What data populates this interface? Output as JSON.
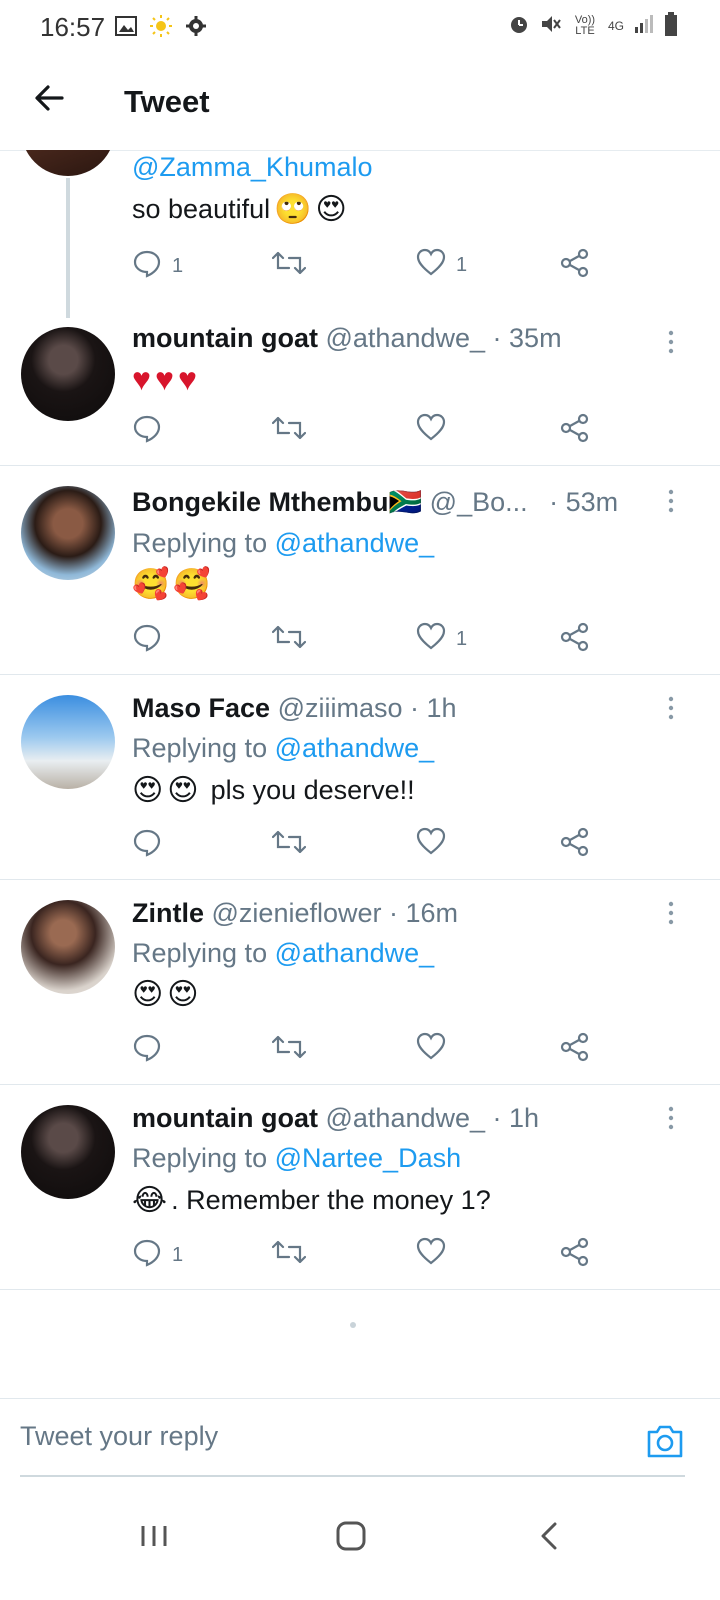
{
  "status_bar": {
    "time": "16:57",
    "left_icons": [
      "image-icon",
      "sun-icon",
      "gear-icon"
    ],
    "right_icons": [
      "alarm-icon",
      "mute-icon",
      "volte-icon",
      "4g-icon",
      "signal-icon",
      "battery-icon"
    ],
    "volte_label": "Vo)) LTE",
    "network_label": "4G"
  },
  "header": {
    "title": "Tweet"
  },
  "tweets": [
    {
      "mention": "@Zamma_Khumalo",
      "text": "so beautiful",
      "emojis": [
        "🙄",
        "😍"
      ],
      "reply_count": "1",
      "like_count": "1"
    },
    {
      "name": "mountain goat",
      "handle": "@athandwe_",
      "time": "· 35m",
      "emojis": [
        "♥",
        "♥",
        "♥"
      ],
      "reply_count": "",
      "like_count": ""
    },
    {
      "name": "Bongekile Mthembu",
      "flag": "🇿🇦",
      "handle": "@_Bo...",
      "time": "· 53m",
      "replying_label": "Replying to",
      "replying_to": "@athandwe_",
      "emojis": [
        "🥰",
        "🥰"
      ],
      "reply_count": "",
      "like_count": "1"
    },
    {
      "name": "Maso Face",
      "handle": "@ziiimaso",
      "time": "· 1h",
      "replying_label": "Replying to",
      "replying_to": "@athandwe_",
      "emojis": [
        "😍",
        "😍"
      ],
      "text": "pls you deserve!!",
      "reply_count": "",
      "like_count": ""
    },
    {
      "name": "Zintle",
      "handle": "@zienieflower",
      "time": "· 16m",
      "replying_label": "Replying to",
      "replying_to": "@athandwe_",
      "emojis": [
        "😍",
        "😍"
      ],
      "reply_count": "",
      "like_count": ""
    },
    {
      "name": "mountain goat",
      "handle": "@athandwe_",
      "time": "· 1h",
      "replying_label": "Replying to",
      "replying_to": "@Nartee_Dash",
      "emojis": [
        "😂"
      ],
      "text": ". Remember the money 1?",
      "reply_count": "1",
      "like_count": ""
    }
  ],
  "reply_bar": {
    "placeholder": "Tweet your reply"
  },
  "colors": {
    "link": "#1d9bf0",
    "secondary_text": "#657786",
    "heart": "#d8152c"
  }
}
